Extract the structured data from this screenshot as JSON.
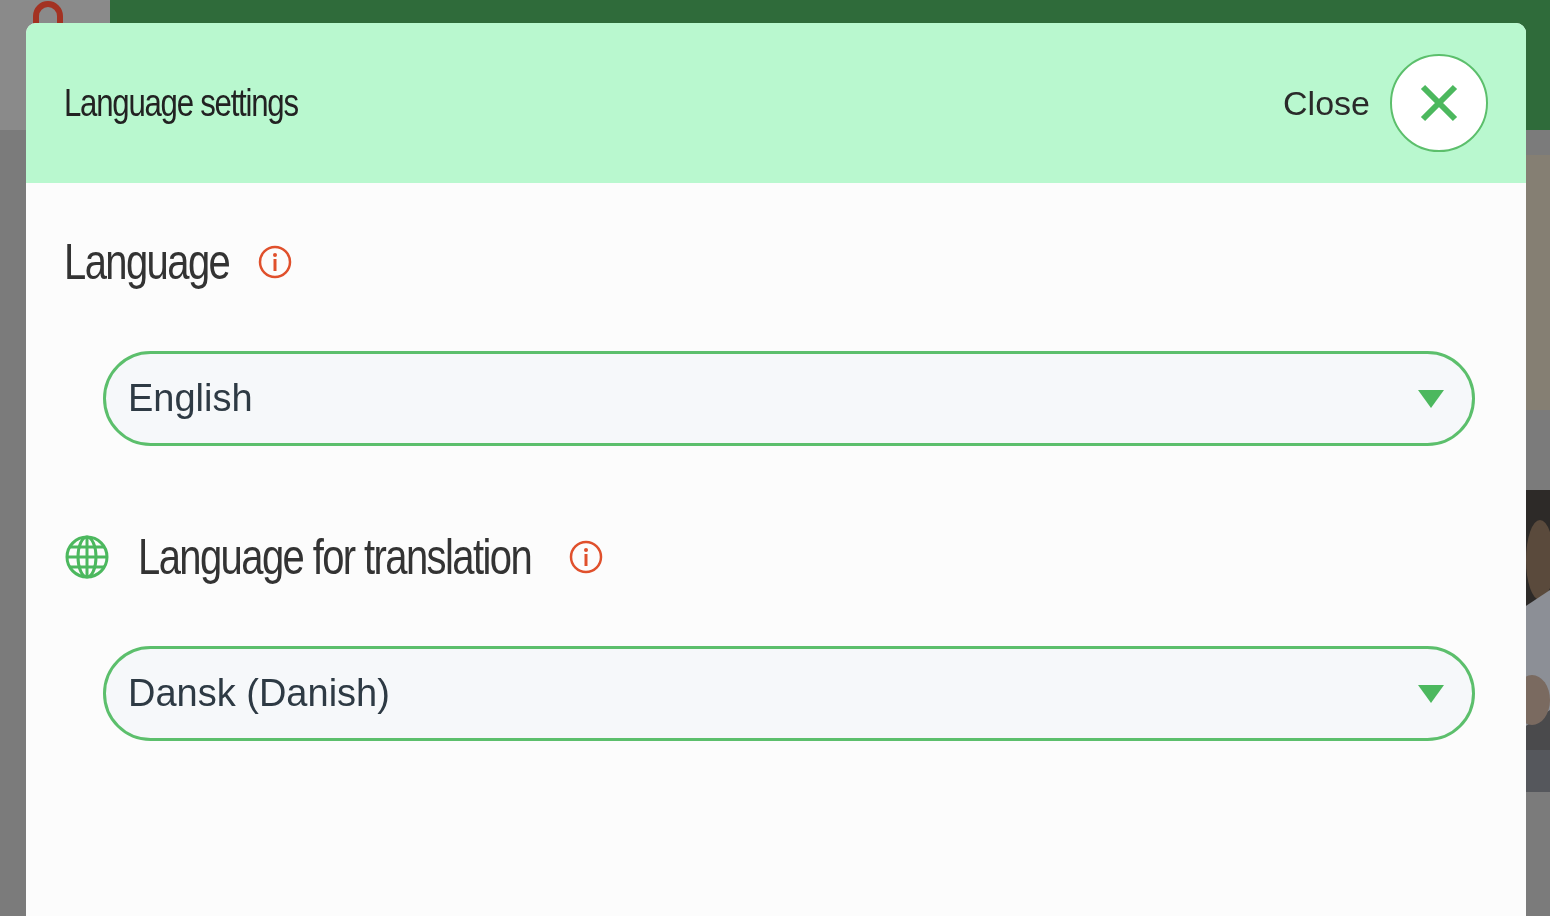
{
  "dialog": {
    "title": "Language settings",
    "close_label": "Close"
  },
  "fields": [
    {
      "kind": "plain",
      "label": "Language",
      "value": "English"
    },
    {
      "kind": "globe",
      "label": "Language for translation",
      "value": "Dansk (Danish)"
    }
  ]
}
